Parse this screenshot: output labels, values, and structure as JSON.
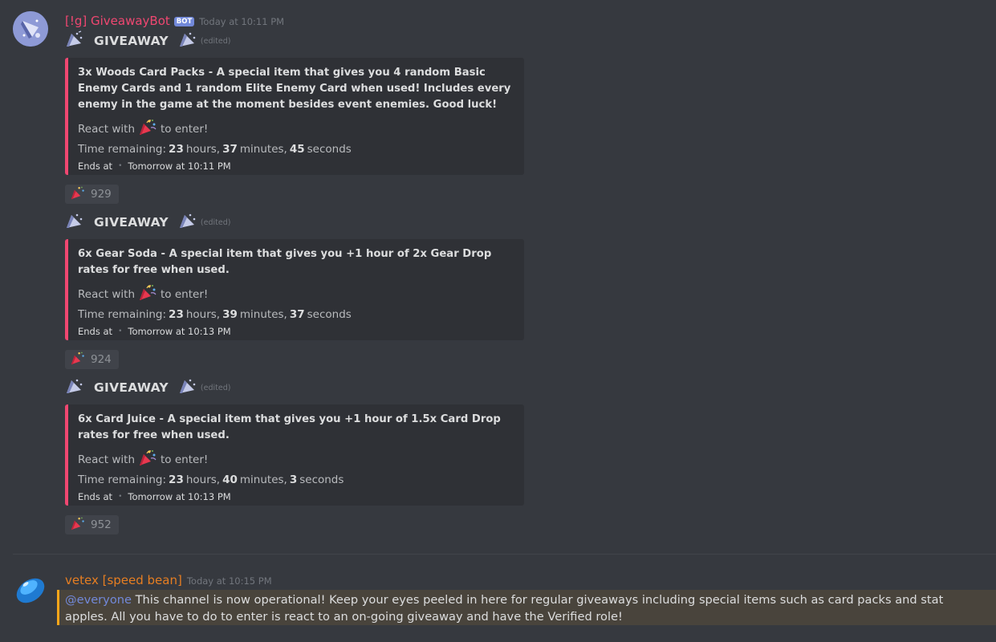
{
  "bot_message": {
    "username": "[!g] GiveawayBot",
    "badge": "BOT",
    "timestamp": "Today at 10:11 PM",
    "username_color": "#f04771"
  },
  "giveaways": [
    {
      "title": "GIVEAWAY",
      "edited": "(edited)",
      "description": "3x Woods Card Packs - A special item that gives you 4 random Basic Enemy Cards and 1 random Elite Enemy Card when used! Includes every enemy in the game at the moment besides event enemies. Good luck!",
      "react_prefix": "React with",
      "react_suffix": "to enter!",
      "time_label": "Time remaining:",
      "hours": "23",
      "hours_label": "hours,",
      "minutes": "37",
      "minutes_label": "minutes,",
      "seconds": "45",
      "seconds_label": "seconds",
      "ends_label": "Ends at",
      "ends_time": "Tomorrow at 10:11 PM",
      "reaction_count": "929"
    },
    {
      "title": "GIVEAWAY",
      "edited": "(edited)",
      "description": "6x Gear Soda - A special item that gives you +1 hour of 2x Gear Drop rates for free when used.",
      "react_prefix": "React with",
      "react_suffix": "to enter!",
      "time_label": "Time remaining:",
      "hours": "23",
      "hours_label": "hours,",
      "minutes": "39",
      "minutes_label": "minutes,",
      "seconds": "37",
      "seconds_label": "seconds",
      "ends_label": "Ends at",
      "ends_time": "Tomorrow at 10:13 PM",
      "reaction_count": "924"
    },
    {
      "title": "GIVEAWAY",
      "edited": "(edited)",
      "description": "6x Card Juice - A special item that gives you +1 hour of 1.5x Card Drop rates for free when used.",
      "react_prefix": "React with",
      "react_suffix": "to enter!",
      "time_label": "Time remaining:",
      "hours": "23",
      "hours_label": "hours,",
      "minutes": "40",
      "minutes_label": "minutes,",
      "seconds": "3",
      "seconds_label": "seconds",
      "ends_label": "Ends at",
      "ends_time": "Tomorrow at 10:13 PM",
      "reaction_count": "952"
    }
  ],
  "user_message": {
    "username": "vetex [speed bean]",
    "timestamp": "Today at 10:15 PM",
    "username_color": "#e67e22",
    "mention": "@everyone",
    "text": "This channel is now operational! Keep your eyes peeled in here for regular giveaways including special items such as card packs and stat apples. All you have to do to enter is react to an on-going giveaway and have the Verified role!"
  },
  "icons": {
    "giveaway_left": "party-horn-icon",
    "giveaway_right": "party-horn-icon",
    "reaction": "tada-icon"
  }
}
